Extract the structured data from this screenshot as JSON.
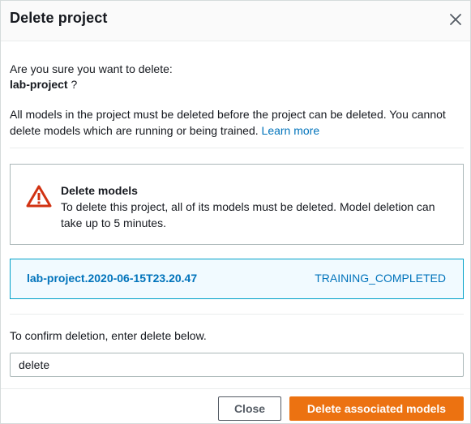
{
  "dialog": {
    "title": "Delete project",
    "close_icon": "close-icon",
    "confirm_question": "Are you sure you want to delete:",
    "project_name": "lab-project",
    "project_suffix": " ?",
    "info_text": "All models in the project must be deleted before the project can be deleted. You cannot delete models which are running or being trained.",
    "learn_more": "Learn more"
  },
  "alert": {
    "icon": "warning-icon",
    "title": "Delete models",
    "body": "To delete this project, all of its models must be deleted. Model deletion can take up to 5 minutes."
  },
  "models": [
    {
      "name": "lab-project.2020-06-15T23.20.47",
      "status": "TRAINING_COMPLETED"
    }
  ],
  "confirm": {
    "label": "To confirm deletion, enter delete below.",
    "value": "delete"
  },
  "footer": {
    "close_label": "Close",
    "delete_label": "Delete associated models"
  },
  "colors": {
    "accent": "#ec7211",
    "link": "#0073bb",
    "warning": "#d13212"
  }
}
